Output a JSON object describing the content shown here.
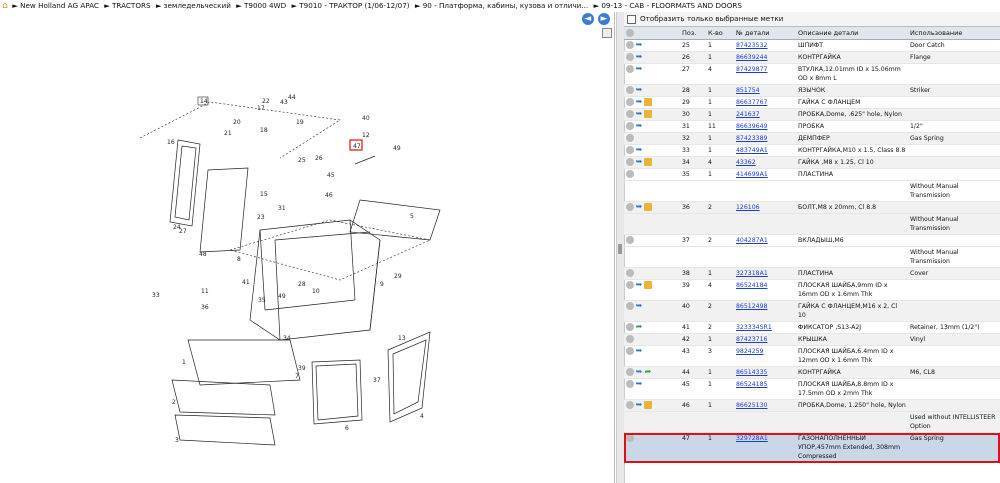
{
  "breadcrumb": {
    "items": [
      "New Holland AG APAC",
      "TRACTORS",
      "земледельческий",
      "T9000 4WD",
      "T9010 - ТРАКТОР (1/06-12/07)",
      "90 - Платформа, кабины, кузова и отличи...",
      "09-13 - CAB - FLOORMATS AND DOORS"
    ]
  },
  "filter": {
    "label": "Отобразить только выбранные метки"
  },
  "table": {
    "headers": [
      "Поз.",
      "К-во",
      "№ детали",
      "Описание детали",
      "Использование"
    ],
    "rows": [
      {
        "pos": "25",
        "qty": "1",
        "part": "87423532",
        "desc": "ШПИФТ",
        "use": "Door Catch",
        "icons": [
          "grey",
          "blue"
        ]
      },
      {
        "pos": "26",
        "qty": "1",
        "part": "86639244",
        "desc": "КОНТРГАЙКА",
        "use": "Flange",
        "icons": [
          "grey",
          "blue"
        ]
      },
      {
        "pos": "27",
        "qty": "4",
        "part": "87429877",
        "desc": "ВТУЛКА,12.01mm ID x 15.06mm OD x 8mm L",
        "use": "",
        "icons": [
          "grey",
          "blue"
        ]
      },
      {
        "pos": "28",
        "qty": "1",
        "part": "851754",
        "desc": "ЯЗЫЧОК",
        "use": "Striker",
        "icons": [
          "grey",
          "blue"
        ]
      },
      {
        "pos": "29",
        "qty": "1",
        "part": "86637767",
        "desc": "ГАЙКА С ФЛАНЦЕМ",
        "use": "",
        "icons": [
          "grey",
          "blue",
          "box"
        ]
      },
      {
        "pos": "30",
        "qty": "1",
        "part": "241637",
        "desc": "ПРОБКА,Dome, .625\" hole, Nylon",
        "use": "",
        "icons": [
          "grey",
          "blue",
          "box"
        ]
      },
      {
        "pos": "31",
        "qty": "11",
        "part": "86639649",
        "desc": "ПРОБКА",
        "use": "1/2\"",
        "icons": [
          "grey",
          "blue"
        ]
      },
      {
        "pos": "32",
        "qty": "1",
        "part": "87423389",
        "desc": "ДЕМПФЕР",
        "use": "Gas Spring",
        "icons": [
          "grey"
        ]
      },
      {
        "pos": "33",
        "qty": "1",
        "part": "483749A1",
        "desc": "КОНТРГАЙКА,M10 x 1.5, Class 8.8",
        "use": "",
        "icons": [
          "grey",
          "blue"
        ]
      },
      {
        "pos": "34",
        "qty": "4",
        "part": "43362",
        "desc": "ГАЙКА ,M8 x 1.25, Cl 10",
        "use": "",
        "icons": [
          "grey",
          "blue",
          "box"
        ]
      },
      {
        "pos": "35",
        "qty": "1",
        "part": "414699A1",
        "desc": "ПЛАСТИНА",
        "use": "",
        "extra": "Without Manual Transmission",
        "icons": [
          "grey"
        ]
      },
      {
        "pos": "36",
        "qty": "2",
        "part": "126106",
        "desc": "БОЛТ,M8 x 20mm, Cl 8.8",
        "use": "",
        "extra": "Without Manual Transmission",
        "icons": [
          "grey",
          "blue",
          "box"
        ]
      },
      {
        "pos": "37",
        "qty": "2",
        "part": "404287A1",
        "desc": "ВКЛАДЫШ,M6",
        "use": "",
        "extra": "Without Manual Transmission",
        "icons": [
          "grey"
        ]
      },
      {
        "pos": "38",
        "qty": "1",
        "part": "327318A1",
        "desc": "ПЛАСТИНА",
        "use": "Cover",
        "icons": [
          "grey"
        ]
      },
      {
        "pos": "39",
        "qty": "4",
        "part": "86524184",
        "desc": "ПЛОСКАЯ ШАЙБА,9mm ID x 16mm OD x 1.6mm Thk",
        "use": "",
        "icons": [
          "grey",
          "blue",
          "box"
        ]
      },
      {
        "pos": "40",
        "qty": "2",
        "part": "86512498",
        "desc": "ГАЙКА С ФЛАНЦЕМ,M16 x 2, Cl 10",
        "use": "",
        "icons": [
          "grey",
          "blue"
        ]
      },
      {
        "pos": "41",
        "qty": "2",
        "part": "323334SR1",
        "desc": "ФИКСАТОР ,S13-A2J",
        "use": "Retainer, 13mm (1/2\")",
        "icons": [
          "grey",
          "green"
        ]
      },
      {
        "pos": "42",
        "qty": "1",
        "part": "87423716",
        "desc": "КРЫШКА",
        "use": "Vinyl",
        "icons": [
          "grey"
        ]
      },
      {
        "pos": "43",
        "qty": "3",
        "part": "9824259",
        "desc": "ПЛОСКАЯ ШАЙБА,6.4mm ID x 12mm OD x 1.6mm Thk",
        "use": "",
        "icons": [
          "grey",
          "blue"
        ]
      },
      {
        "pos": "44",
        "qty": "1",
        "part": "86514335",
        "desc": "КОНТРГАЙКА",
        "use": "M6, CL8",
        "icons": [
          "grey",
          "blue",
          "green"
        ]
      },
      {
        "pos": "45",
        "qty": "1",
        "part": "86524185",
        "desc": "ПЛОСКАЯ ШАЙБА,8.8mm ID x 17.5mm OD x 2mm Thk",
        "use": "",
        "icons": [
          "grey",
          "blue"
        ]
      },
      {
        "pos": "46",
        "qty": "1",
        "part": "86625130",
        "desc": "ПРОБКА,Dome, 1.250\" hole, Nylon",
        "use": "",
        "extra": "Used without INTELLISTEER Option",
        "icons": [
          "grey",
          "blue",
          "box"
        ]
      },
      {
        "pos": "47",
        "qty": "1",
        "part": "329728A1",
        "desc": "ГАЗОНАПОЛНЕННЫЙ УПОР,457mm Extended, 308mm Compressed",
        "use": "Gas Spring",
        "icons": [
          "grey"
        ],
        "selected": true
      }
    ]
  },
  "diagram": {
    "callouts": [
      "14",
      "22",
      "17",
      "43",
      "44",
      "20",
      "18",
      "19",
      "21",
      "12",
      "40",
      "16",
      "47",
      "49",
      "25",
      "26",
      "45",
      "46",
      "31",
      "15",
      "23",
      "24",
      "27",
      "5",
      "8",
      "48",
      "41",
      "11",
      "36",
      "35",
      "29",
      "9",
      "28",
      "10",
      "38",
      "33",
      "49",
      "30",
      "34",
      "39",
      "1",
      "7",
      "2",
      "3",
      "6",
      "4",
      "13",
      "37"
    ],
    "highlight": "47"
  }
}
